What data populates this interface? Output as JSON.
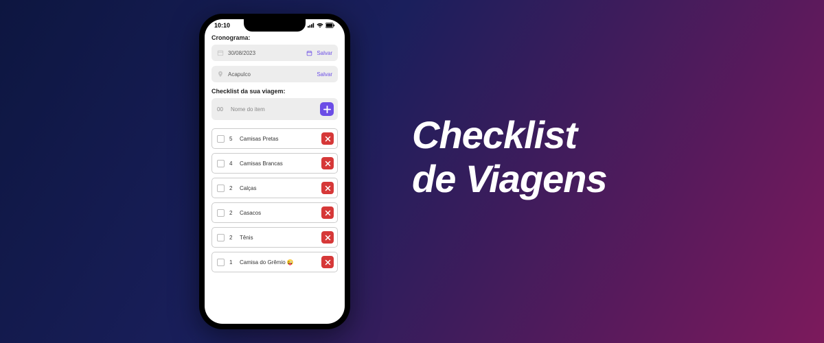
{
  "hero": {
    "line1": "Checklist",
    "line2": "de Viagens"
  },
  "statusBar": {
    "time": "10:10"
  },
  "cronograma": {
    "label": "Cronograma:",
    "date": "30/08/2023",
    "dateSave": "Salvar",
    "place": "Acapulco",
    "placeSave": "Salvar"
  },
  "checklist": {
    "label": "Checklist da sua viagem:",
    "qtyPlaceholder": "00",
    "namePlaceholder": "Nome do item",
    "items": [
      {
        "qty": "5",
        "name": "Camisas Pretas"
      },
      {
        "qty": "4",
        "name": "Camisas Brancas"
      },
      {
        "qty": "2",
        "name": "Calças"
      },
      {
        "qty": "2",
        "name": "Casacos"
      },
      {
        "qty": "2",
        "name": "Tênis"
      },
      {
        "qty": "1",
        "name": "Camisa do Grêmio 😜"
      }
    ]
  }
}
